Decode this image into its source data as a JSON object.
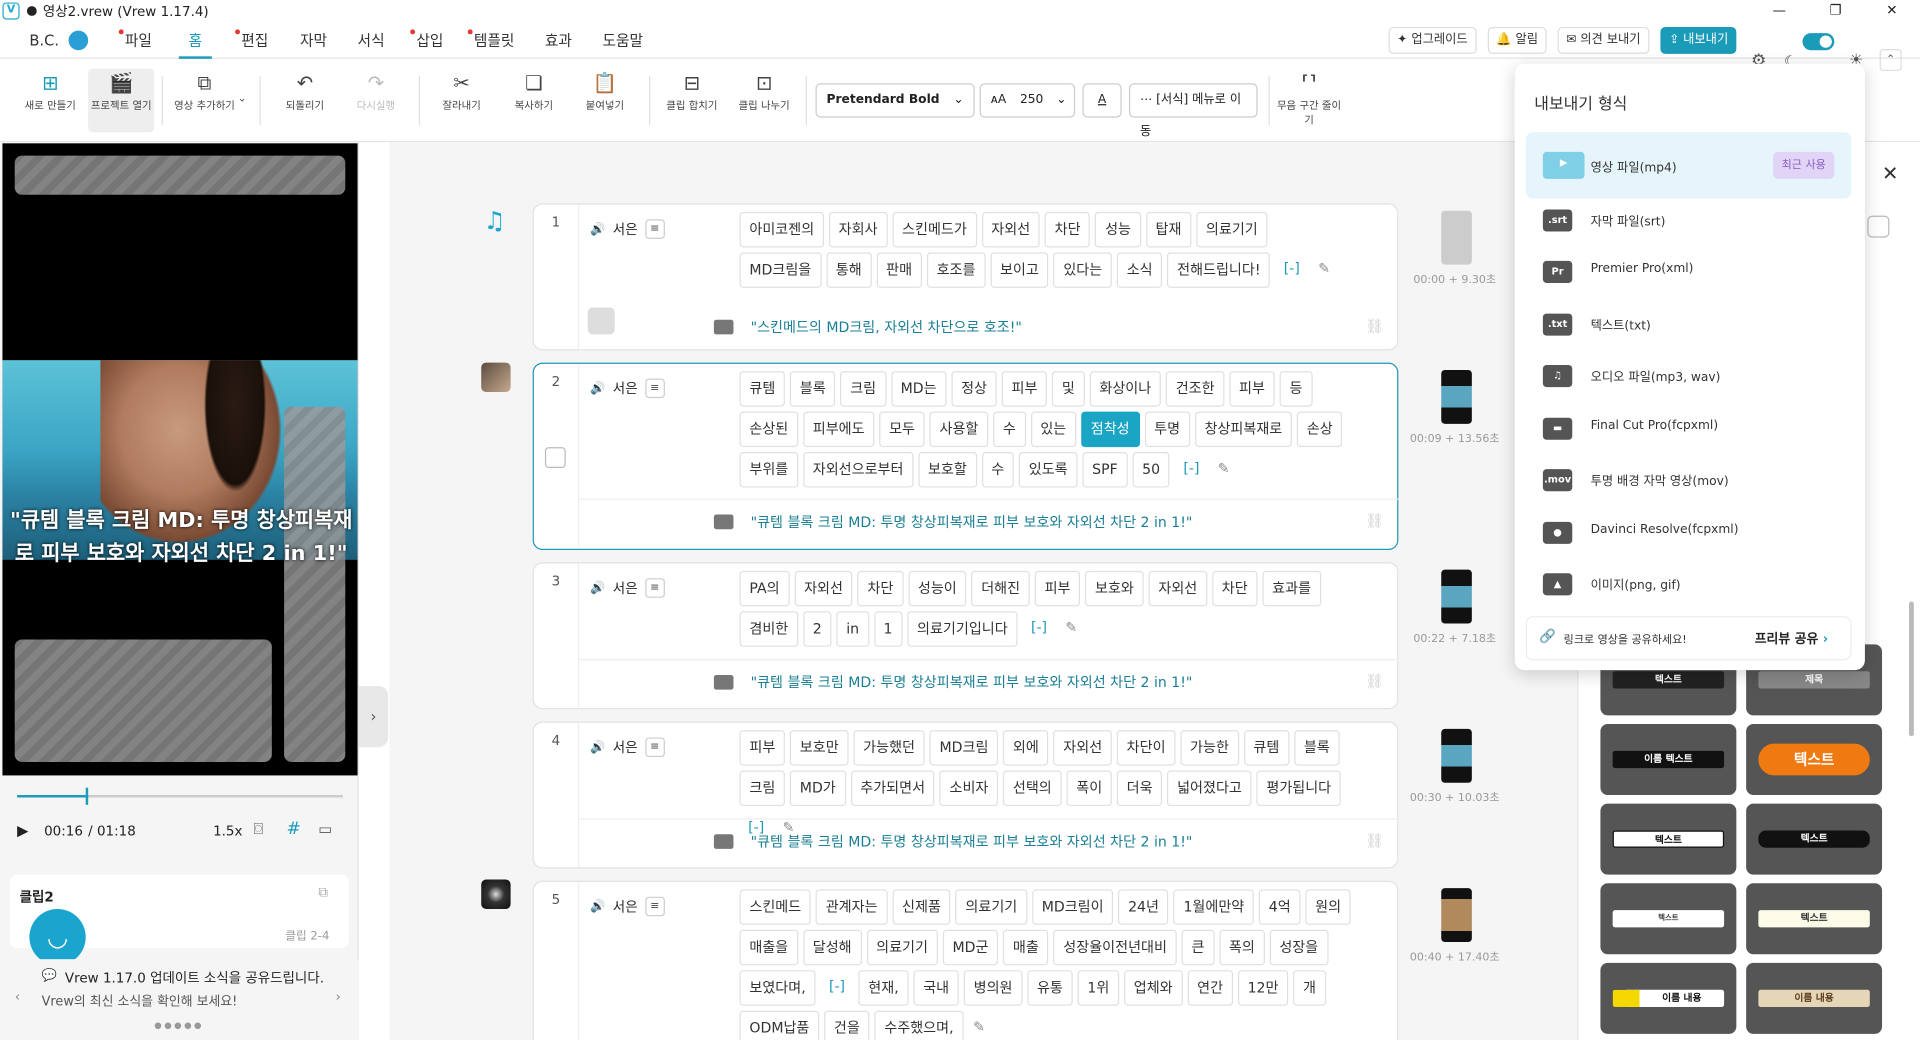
{
  "window": {
    "title": "영상2.vrew (Vrew 1.17.4)",
    "controls": [
      "—",
      "❐",
      "✕"
    ]
  },
  "menubar": {
    "user": "B.C.",
    "items": [
      {
        "label": "파일",
        "dot": true
      },
      {
        "label": "홈",
        "dot": false,
        "active": true
      },
      {
        "label": "편집",
        "dot": true
      },
      {
        "label": "자막",
        "dot": false
      },
      {
        "label": "서식",
        "dot": false
      },
      {
        "label": "삽입",
        "dot": true
      },
      {
        "label": "템플릿",
        "dot": true
      },
      {
        "label": "효과",
        "dot": false
      },
      {
        "label": "도움말",
        "dot": false
      }
    ],
    "upgrade": "업그레이드",
    "notify": "알림",
    "feedback": "의견 보내기",
    "export": "내보내기"
  },
  "toolbar": {
    "new": "새로 만들기",
    "open": "프로젝트 열기",
    "add_video": "영상 추가하기",
    "undo": "되돌리기",
    "redo": "다시실행",
    "cut": "잘라내기",
    "copy": "복사하기",
    "paste": "붙여넣기",
    "merge": "클립 합치기",
    "split": "클립 나누기",
    "font": "Pretendard Bold",
    "size": "250",
    "format_menu": "[서식] 메뉴로 이동",
    "silence": "무음 구간 줄이기"
  },
  "preview": {
    "caption": "\"큐템 블록 크림 MD: 투명 창상피복재로 피부 보호와 자외선 차단 2 in 1!\"",
    "current": "00:16",
    "total": "/ 01:18",
    "speed": "1.5x",
    "progress": 0.22
  },
  "clip_panel": {
    "title": "클립2",
    "range": "클립 2-4"
  },
  "news": {
    "headline": "Vrew 1.17.0 업데이트 소식을 공유드립니다.",
    "sub": "Vrew의 최신 소식을 확인해 보세요!"
  },
  "clips": [
    {
      "num": "1",
      "speaker": "서은",
      "time": "00:00 + 9.30초",
      "words": [
        "아미코젠의",
        "자회사",
        "스킨메드가",
        "자외선",
        "차단",
        "성능",
        "탑재",
        "의료기기",
        "MD크림을",
        "통해",
        "판매",
        "호조를",
        "보이고",
        "있다는",
        "소식",
        "전해드립니다!"
      ],
      "subtitle": "\"스킨메드의 MD크림, 자외선 차단으로 호조!\""
    },
    {
      "num": "2",
      "speaker": "서은",
      "time": "00:09 + 13.56초",
      "words": [
        "큐템",
        "블록",
        "크림",
        "MD는",
        "정상",
        "피부",
        "및",
        "화상이나",
        "건조한",
        "피부",
        "등",
        "손상된",
        "피부에도",
        "모두",
        "사용할",
        "수",
        "있는",
        "점착성",
        "투명",
        "창상피복재로",
        "손상",
        "부위를",
        "자외선으로부터",
        "보호할",
        "수",
        "있도록",
        "SPF",
        "50"
      ],
      "subtitle": "\"큐템 블록 크림 MD: 투명 창상피복재로 피부 보호와 자외선 차단 2 in 1!\""
    },
    {
      "num": "3",
      "speaker": "서은",
      "time": "00:22 + 7.18초",
      "words": [
        "PA의",
        "자외선",
        "차단",
        "성능이",
        "더해진",
        "피부",
        "보호와",
        "자외선",
        "차단",
        "효과를",
        "겸비한",
        "2",
        "in",
        "1",
        "의료기기입니다"
      ],
      "subtitle": "\"큐템 블록 크림 MD: 투명 창상피복재로 피부 보호와 자외선 차단 2 in 1!\""
    },
    {
      "num": "4",
      "speaker": "서은",
      "time": "00:30 + 10.03초",
      "words": [
        "피부",
        "보호만",
        "가능했던",
        "MD크림",
        "외에",
        "자외선",
        "차단이",
        "가능한",
        "큐템",
        "블록",
        "크림",
        "MD가",
        "추가되면서",
        "소비자",
        "선택의",
        "폭이",
        "더욱",
        "넓어졌다고",
        "평가됩니다"
      ],
      "subtitle": "\"큐템 블록 크림 MD: 투명 창상피복재로 피부 보호와 자외선 차단 2 in 1!\""
    },
    {
      "num": "5",
      "speaker": "서은",
      "time": "00:40 + 17.40초",
      "words": [
        "스킨메드",
        "관계자는",
        "신제품",
        "의료기기",
        "MD크림이",
        "24년",
        "1월에만약",
        "4억",
        "원의",
        "매출을",
        "달성해",
        "의료기기",
        "MD군",
        "매출",
        "성장율이전년대비",
        "큰",
        "폭의",
        "성장을",
        "보였다며,",
        "[-]",
        "현재,",
        "국내",
        "병의원",
        "유통",
        "1위",
        "업체와",
        "연간",
        "12만",
        "개",
        "ODM납품",
        "건을",
        "수주했으며,"
      ],
      "subtitle": ""
    }
  ],
  "templates": [
    "텍스트",
    "제목",
    "이름 텍스트",
    "텍스트",
    "텍스트",
    "텍스트",
    "텍스트",
    "텍스트",
    "이름 내용",
    "이름 내용"
  ],
  "export_menu": {
    "title": "내보내기 형식",
    "recent_badge": "최근 사용",
    "options": [
      {
        "icon": "▶",
        "label": "영상 파일(mp4)"
      },
      {
        "icon": ".srt",
        "label": "자막 파일(srt)"
      },
      {
        "icon": "Pr",
        "label": "Premier Pro(xml)"
      },
      {
        "icon": ".txt",
        "label": "텍스트(txt)"
      },
      {
        "icon": "♫",
        "label": "오디오 파일(mp3, wav)"
      },
      {
        "icon": "▬",
        "label": "Final Cut Pro(fcpxml)"
      },
      {
        "icon": ".mov",
        "label": "투명 배경 자막 영상(mov)"
      },
      {
        "icon": "●",
        "label": "Davinci Resolve(fcpxml)"
      },
      {
        "icon": "▲",
        "label": "이미지(png, gif)"
      }
    ],
    "share_text": "링크로 영상을 공유하세요!",
    "share_btn": "프리뷰 공유"
  },
  "colors": {
    "accent": "#1a9bb8",
    "highlight": "#1aa5c4",
    "badge_bg": "#e1d4f6"
  }
}
